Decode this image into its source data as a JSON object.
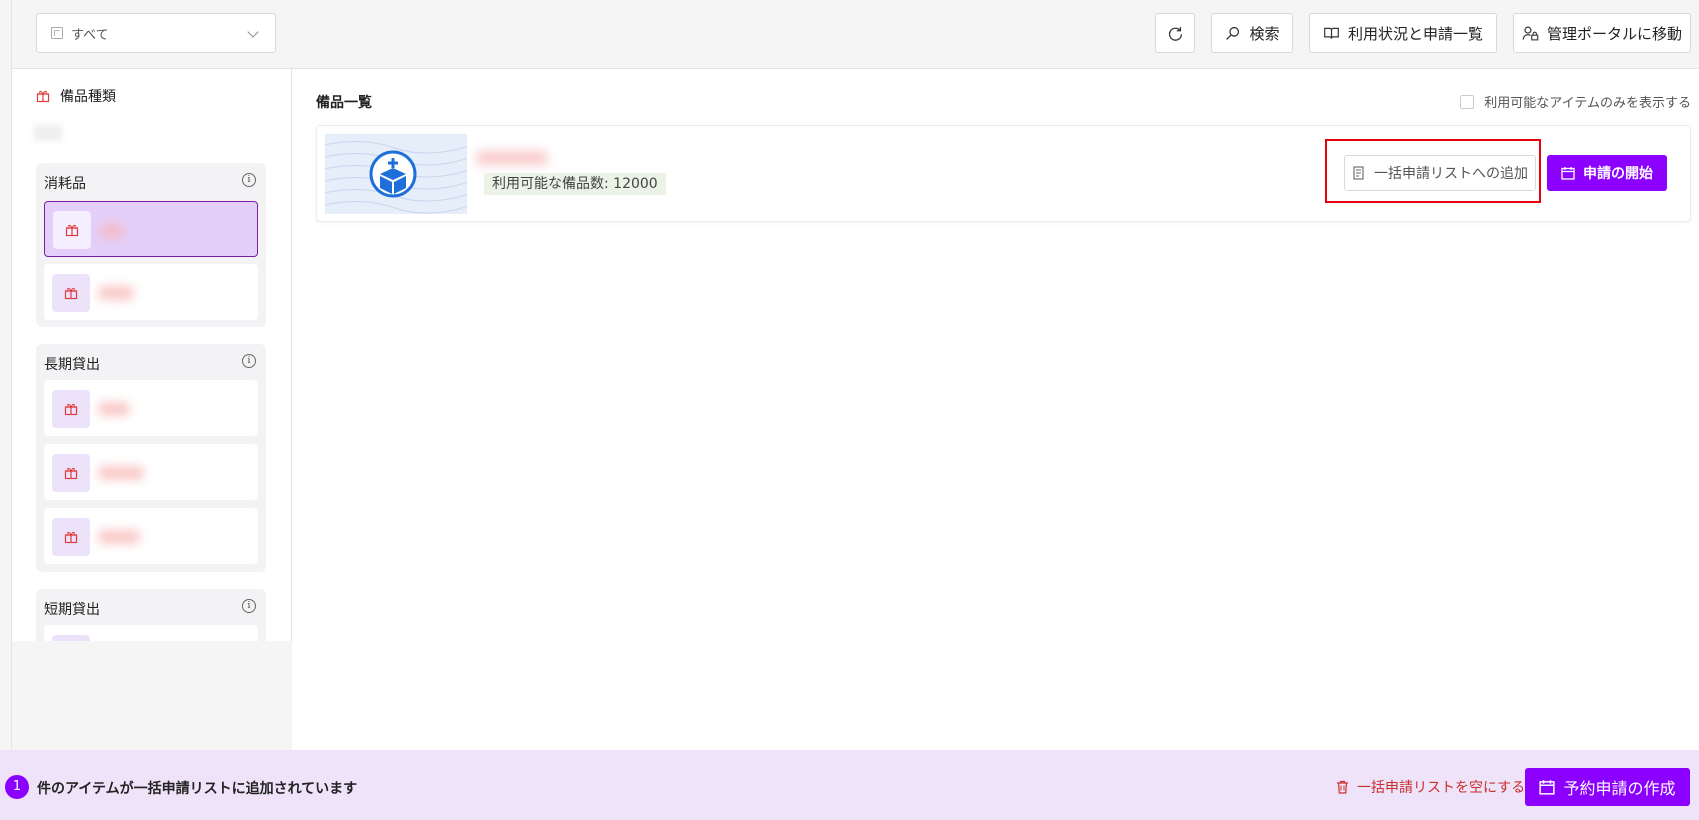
{
  "header": {
    "filter_select": {
      "value": "すべて",
      "icon": "building-icon"
    },
    "buttons": {
      "refresh": {
        "icon": "refresh-icon"
      },
      "search": {
        "label": "検索",
        "icon": "search-icon"
      },
      "usage": {
        "label": "利用状況と申請一覧",
        "icon": "book-icon"
      },
      "admin": {
        "label": "管理ポータルに移動",
        "icon": "user-lock-icon"
      }
    }
  },
  "sidebar": {
    "title": "備品種類",
    "groups": [
      {
        "title": "消耗品",
        "info": "i"
      },
      {
        "title": "長期貸出",
        "info": "i"
      },
      {
        "title": "短期貸出",
        "info": "i"
      }
    ]
  },
  "main": {
    "title": "備品一覧",
    "filter_checkbox_label": "利用可能なアイテムのみを表示する",
    "item": {
      "available_label": "利用可能な備品数: 12000",
      "add_button_label": "一括申請リストへの追加",
      "start_button_label": "申請の開始"
    }
  },
  "footer": {
    "count": "1",
    "message": "件のアイテムが一括申請リストに追加されています",
    "clear_label": "一括申請リストを空にする",
    "create_label": "予約申請の作成"
  },
  "colors": {
    "accent": "#8b00ff",
    "selected_bg": "#e4cffa",
    "highlight": "#e8000b",
    "danger": "#c9302c",
    "footer_bg": "#efe3fa"
  }
}
